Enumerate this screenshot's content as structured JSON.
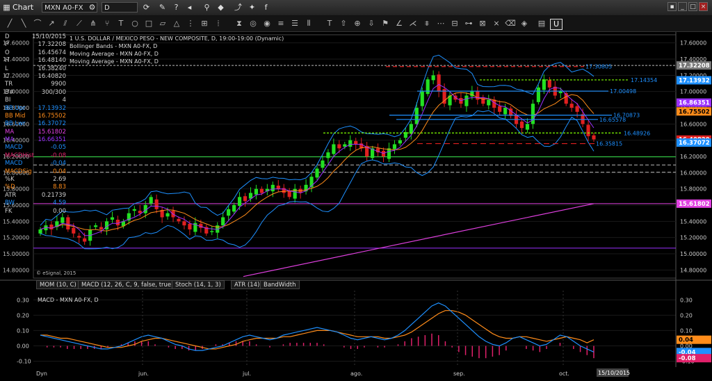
{
  "window": {
    "title": "Chart",
    "symbol": "MXN A0-FX",
    "interval": "D"
  },
  "colors": {
    "up": "#22e022",
    "down": "#e02020",
    "bb": "#1e90ff",
    "ema_orange": "#ff8c1a",
    "ma_magenta": "#e040e0",
    "accent_label_bb": "#1e90ff"
  },
  "header_text": {
    "l1": "1 U.S. DOLLAR / MEXICO PESO - NEW COMPOSITE, D, 19:00-19:00 (Dynamic)",
    "l2": "Bollinger Bands - MXN A0-FX, D",
    "l3": "Moving Average - MXN A0-FX, D",
    "l4": "Moving Average - MXN A0-FX, D"
  },
  "data_window": [
    {
      "label": "D",
      "value": "15/10/2015",
      "color": "#cccccc"
    },
    {
      "label": "P",
      "value": "17.32208",
      "color": "#cccccc"
    },
    {
      "label": "O",
      "value": "16.45674",
      "color": "#cccccc"
    },
    {
      "label": "H",
      "value": "16.48140",
      "color": "#cccccc"
    },
    {
      "label": "L",
      "value": "16.38240",
      "color": "#cccccc"
    },
    {
      "label": "C",
      "value": "16.40820",
      "color": "#cccccc"
    },
    {
      "label": "TR",
      "value": "9900",
      "color": "#cccccc"
    },
    {
      "label": "B#",
      "value": "300/300",
      "color": "#cccccc"
    },
    {
      "label": "BI",
      "value": "4",
      "color": "#cccccc"
    },
    {
      "label": "BB Upr",
      "value": "17.13932",
      "color": "#1e90ff"
    },
    {
      "label": "BB Mid",
      "value": "16.75502",
      "color": "#ff8c1a"
    },
    {
      "label": "BB Lwr",
      "value": "16.37072",
      "color": "#1e90ff"
    },
    {
      "label": "MA",
      "value": "15.61802",
      "color": "#e040e0"
    },
    {
      "label": "MA",
      "value": "16.66351",
      "color": "#9b30ff"
    },
    {
      "label": "MACD",
      "value": "-0.05",
      "color": "#1e90ff"
    },
    {
      "label": "MACDHist",
      "value": "-0.08",
      "color": "#e0206a"
    },
    {
      "label": "MACD",
      "value": "-0.04",
      "color": "#1e90ff"
    },
    {
      "label": "MACDSig",
      "value": "0.04",
      "color": "#ff8c1a"
    },
    {
      "label": "%K",
      "value": "2.69",
      "color": "#cccccc"
    },
    {
      "label": "%D",
      "value": "8.83",
      "color": "#ff8c1a"
    },
    {
      "label": "ATR",
      "value": "0.21739",
      "color": "#cccccc"
    },
    {
      "label": "BW",
      "value": "4.59",
      "color": "#1e90ff"
    },
    {
      "label": "FK",
      "value": "0.00",
      "color": "#cccccc"
    }
  ],
  "copyright": "© eSignal, 2015",
  "price_axis": {
    "ticks": [
      "17.60000",
      "17.40000",
      "17.20000",
      "17.00000",
      "16.80000",
      "16.60000",
      "16.40000",
      "16.20000",
      "16.00000",
      "15.80000",
      "15.60000",
      "15.40000",
      "15.20000",
      "15.00000",
      "14.80000"
    ],
    "tags": [
      {
        "text": "17.32208",
        "value": 17.322,
        "bg": "#777777",
        "fg": "#ffffff"
      },
      {
        "text": "17.13932",
        "value": 17.139,
        "bg": "#1e90ff",
        "fg": "#ffffff"
      },
      {
        "text": "16.86351",
        "value": 16.8635,
        "bg": "#9b30ff",
        "fg": "#ffffff"
      },
      {
        "text": "16.75502",
        "value": 16.755,
        "bg": "#ff8c1a",
        "fg": "#000000"
      },
      {
        "text": "16.40820",
        "value": 16.4082,
        "bg": "#e02020",
        "fg": "#ffffff"
      },
      {
        "text": "16.37072",
        "value": 16.3707,
        "bg": "#1e90ff",
        "fg": "#ffffff"
      },
      {
        "text": "15.61802",
        "value": 15.618,
        "bg": "#e040e0",
        "fg": "#ffffff"
      }
    ]
  },
  "level_labels": [
    {
      "text": "17.30805",
      "value": 17.30805
    },
    {
      "text": "17.14354",
      "value": 17.14354
    },
    {
      "text": "17.00498",
      "value": 17.00498
    },
    {
      "text": "16.70873",
      "value": 16.70873
    },
    {
      "text": "16.65578",
      "value": 16.65578
    },
    {
      "text": "16.48926",
      "value": 16.48926
    },
    {
      "text": "16.35815",
      "value": 16.35815
    }
  ],
  "sub_tabs": [
    "MOM (10, C)",
    "MACD (12, 26, C, 9, false, true)",
    "Stoch (14, 1, 3)",
    "ATR (14)",
    "BandWidth"
  ],
  "macd_title": "MACD - MXN A0-FX, D",
  "macd_axis": {
    "ticks": [
      "0.30",
      "0.20",
      "0.10",
      "0.00",
      "-0.10"
    ],
    "tags": [
      {
        "text": "0.04",
        "value": 0.04,
        "bg": "#ff8c1a",
        "fg": "#000000"
      },
      {
        "text": "-0.04",
        "value": -0.04,
        "bg": "#1e90ff",
        "fg": "#ffffff"
      },
      {
        "text": "-0.08",
        "value": -0.08,
        "bg": "#e0206a",
        "fg": "#ffffff"
      }
    ]
  },
  "x_axis": {
    "labels": [
      "Dyn",
      "jun.",
      "jul.",
      "ago.",
      "sep.",
      "oct.",
      "15/10/2015"
    ]
  },
  "chart_data": {
    "type": "candlestick",
    "title": "1 U.S. DOLLAR / MEXICO PESO - NEW COMPOSITE, D, 19:00-19:00 (Dynamic)",
    "ylim": [
      14.7,
      17.7
    ],
    "months": [
      "jun.",
      "jul.",
      "ago.",
      "sep.",
      "oct."
    ],
    "close_path": [
      15.3,
      15.35,
      15.3,
      15.4,
      15.45,
      15.3,
      15.25,
      15.2,
      15.15,
      15.3,
      15.35,
      15.3,
      15.4,
      15.45,
      15.35,
      15.4,
      15.5,
      15.55,
      15.5,
      15.6,
      15.7,
      15.55,
      15.45,
      15.5,
      15.45,
      15.4,
      15.35,
      15.3,
      15.38,
      15.32,
      15.25,
      15.28,
      15.35,
      15.45,
      15.55,
      15.6,
      15.7,
      15.65,
      15.75,
      15.8,
      15.75,
      15.8,
      15.85,
      15.8,
      15.75,
      15.7,
      15.8,
      15.75,
      15.85,
      15.95,
      16.05,
      16.15,
      16.25,
      16.35,
      16.3,
      16.35,
      16.4,
      16.35,
      16.3,
      16.2,
      16.3,
      16.25,
      16.2,
      16.3,
      16.35,
      16.4,
      16.5,
      16.6,
      16.8,
      17.0,
      17.15,
      17.2,
      17.0,
      16.85,
      16.95,
      16.9,
      16.85,
      16.95,
      17.0,
      16.9,
      16.85,
      16.9,
      16.8,
      16.75,
      16.8,
      16.7,
      16.6,
      16.55,
      16.6,
      16.85,
      17.05,
      17.15,
      17.05,
      16.95,
      17.0,
      16.85,
      16.8,
      16.75,
      16.6,
      16.45,
      16.41
    ],
    "macd_ylim": [
      -0.12,
      0.36
    ],
    "macd_line": [
      0.07,
      0.06,
      0.05,
      0.04,
      0.03,
      0.02,
      0.01,
      0.0,
      -0.01,
      -0.02,
      -0.02,
      -0.01,
      0.0,
      0.02,
      0.04,
      0.06,
      0.07,
      0.06,
      0.05,
      0.03,
      0.01,
      0.0,
      -0.02,
      -0.03,
      -0.03,
      -0.02,
      -0.01,
      0.0,
      0.02,
      0.04,
      0.06,
      0.07,
      0.06,
      0.05,
      0.04,
      0.05,
      0.07,
      0.08,
      0.09,
      0.1,
      0.11,
      0.12,
      0.11,
      0.1,
      0.09,
      0.07,
      0.05,
      0.04,
      0.05,
      0.06,
      0.05,
      0.04,
      0.05,
      0.07,
      0.1,
      0.14,
      0.18,
      0.22,
      0.26,
      0.28,
      0.26,
      0.22,
      0.18,
      0.14,
      0.1,
      0.06,
      0.03,
      0.01,
      0.0,
      0.02,
      0.05,
      0.06,
      0.04,
      0.02,
      0.0,
      0.01,
      0.04,
      0.07,
      0.06,
      0.03,
      0.0,
      -0.02,
      -0.04
    ],
    "signal_line": [
      0.07,
      0.07,
      0.06,
      0.05,
      0.05,
      0.04,
      0.03,
      0.02,
      0.01,
      0.0,
      -0.01,
      -0.01,
      -0.01,
      0.0,
      0.01,
      0.03,
      0.04,
      0.05,
      0.05,
      0.04,
      0.03,
      0.02,
      0.01,
      0.0,
      -0.01,
      -0.02,
      -0.02,
      -0.01,
      0.0,
      0.01,
      0.03,
      0.04,
      0.05,
      0.05,
      0.05,
      0.05,
      0.06,
      0.06,
      0.07,
      0.08,
      0.09,
      0.1,
      0.1,
      0.1,
      0.09,
      0.08,
      0.07,
      0.06,
      0.06,
      0.06,
      0.06,
      0.05,
      0.05,
      0.06,
      0.07,
      0.09,
      0.12,
      0.15,
      0.18,
      0.21,
      0.23,
      0.23,
      0.22,
      0.2,
      0.17,
      0.14,
      0.11,
      0.08,
      0.06,
      0.05,
      0.05,
      0.06,
      0.06,
      0.05,
      0.04,
      0.03,
      0.04,
      0.05,
      0.06,
      0.05,
      0.04,
      0.02,
      0.04
    ],
    "histogram": [
      0.0,
      -0.01,
      -0.01,
      -0.01,
      -0.02,
      -0.02,
      -0.02,
      -0.02,
      -0.02,
      -0.02,
      -0.01,
      0.0,
      0.01,
      0.02,
      0.03,
      0.03,
      0.03,
      0.01,
      0.0,
      -0.01,
      -0.02,
      -0.02,
      -0.03,
      -0.03,
      -0.02,
      0.0,
      0.01,
      0.01,
      0.02,
      0.03,
      0.03,
      0.03,
      0.01,
      0.0,
      -0.01,
      0.0,
      0.01,
      0.02,
      0.02,
      0.02,
      0.02,
      0.02,
      0.01,
      0.0,
      0.0,
      -0.01,
      -0.02,
      -0.02,
      -0.01,
      0.0,
      -0.01,
      -0.01,
      0.0,
      0.01,
      0.03,
      0.05,
      0.06,
      0.07,
      0.08,
      0.07,
      0.03,
      -0.01,
      -0.04,
      -0.06,
      -0.07,
      -0.08,
      -0.08,
      -0.07,
      -0.06,
      -0.03,
      0.0,
      0.0,
      -0.02,
      -0.03,
      -0.04,
      -0.02,
      0.0,
      0.02,
      0.0,
      -0.02,
      -0.04,
      -0.06,
      -0.08
    ]
  }
}
